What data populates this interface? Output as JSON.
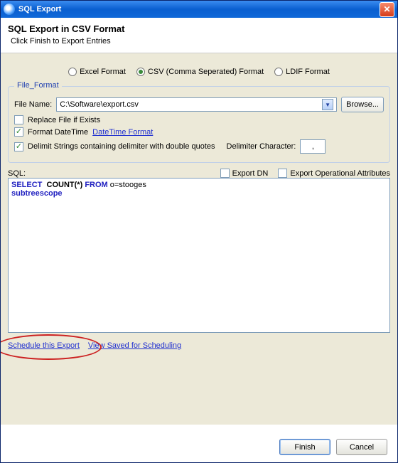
{
  "window": {
    "title": "SQL Export"
  },
  "banner": {
    "title": "SQL Export in CSV Format",
    "subtitle": "Click Finish to Export Entries"
  },
  "format_radios": {
    "excel": "Excel Format",
    "csv": "CSV (Comma Seperated) Format",
    "ldif": "LDIF Format"
  },
  "file_format": {
    "legend": "File_Format",
    "file_name_label": "File Name:",
    "file_name_value": "C:\\Software\\export.csv",
    "browse": "Browse...",
    "replace": "Replace File if Exists",
    "format_dt": "Format DateTime",
    "dt_link": "DateTime Format",
    "delimit_strings": "Delimit Strings containing delimiter with double quotes",
    "delim_char_label": "Delimiter Character:",
    "delim_char_value": ","
  },
  "sql": {
    "label": "SQL:",
    "export_dn": "Export DN",
    "export_op": "Export Operational Attributes",
    "query_kw1": "SELECT",
    "query_fn": "COUNT(*)",
    "query_kw2": "FROM",
    "query_rest": "o=stooges",
    "subtree": "subtreescope"
  },
  "links": {
    "schedule": "Schedule this Export",
    "viewsaved": "View Saved for Scheduling"
  },
  "buttons": {
    "finish": "Finish",
    "cancel": "Cancel"
  }
}
